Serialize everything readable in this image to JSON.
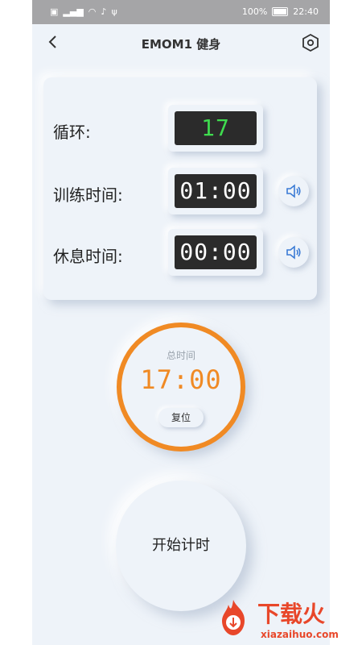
{
  "status_bar": {
    "left_icons": [
      "sim-icon",
      "signal-icon",
      "wifi-icon",
      "bell-mute-icon",
      "usb-icon"
    ],
    "battery_percent": "100%",
    "time": "22:40"
  },
  "header": {
    "title": "EMOM1 健身"
  },
  "settings": {
    "rows": [
      {
        "label": "循环:",
        "value": "17",
        "has_sound": false
      },
      {
        "label": "训练时间:",
        "value": "01:00",
        "has_sound": true
      },
      {
        "label": "休息时间:",
        "value": "00:00",
        "has_sound": true
      }
    ]
  },
  "timer": {
    "label": "总时间",
    "value": "17:00",
    "reset_label": "复位",
    "accent_color": "#f08a24"
  },
  "start": {
    "label": "开始计时"
  },
  "watermark": {
    "text": "下载火",
    "url": "xiazaihuo.com"
  },
  "colors": {
    "background": "#eef3f9",
    "cycle_digits": "#3fdc4f",
    "watermark": "#e8472a",
    "sound_icon": "#3a7bd5"
  }
}
